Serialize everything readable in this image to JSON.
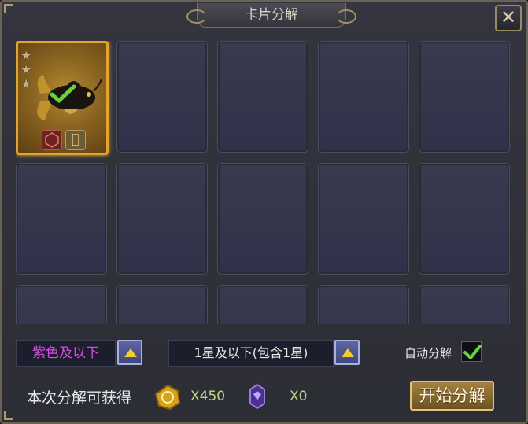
{
  "window": {
    "title": "卡片分解",
    "close_label": "✕"
  },
  "grid": {
    "columns": 5,
    "visible_rows": 3,
    "cards": [
      {
        "slot": 0,
        "stars": 3,
        "selected": true,
        "frame_color": "#e4a230"
      }
    ]
  },
  "filters": {
    "quality_value": "紫色及以下",
    "quality_color": "#d74be8",
    "star_value": "1星及以下(包含1星)",
    "auto_label": "自动分解",
    "auto_checked": true
  },
  "rewards": {
    "label": "本次分解可获得",
    "gold_count": "X450",
    "gem_count": "X0"
  },
  "actions": {
    "start_label": "开始分解"
  },
  "colors": {
    "accent_gold": "#e4a230",
    "check_green": "#6ad13a",
    "arrow_yellow": "#f2cf2a"
  }
}
